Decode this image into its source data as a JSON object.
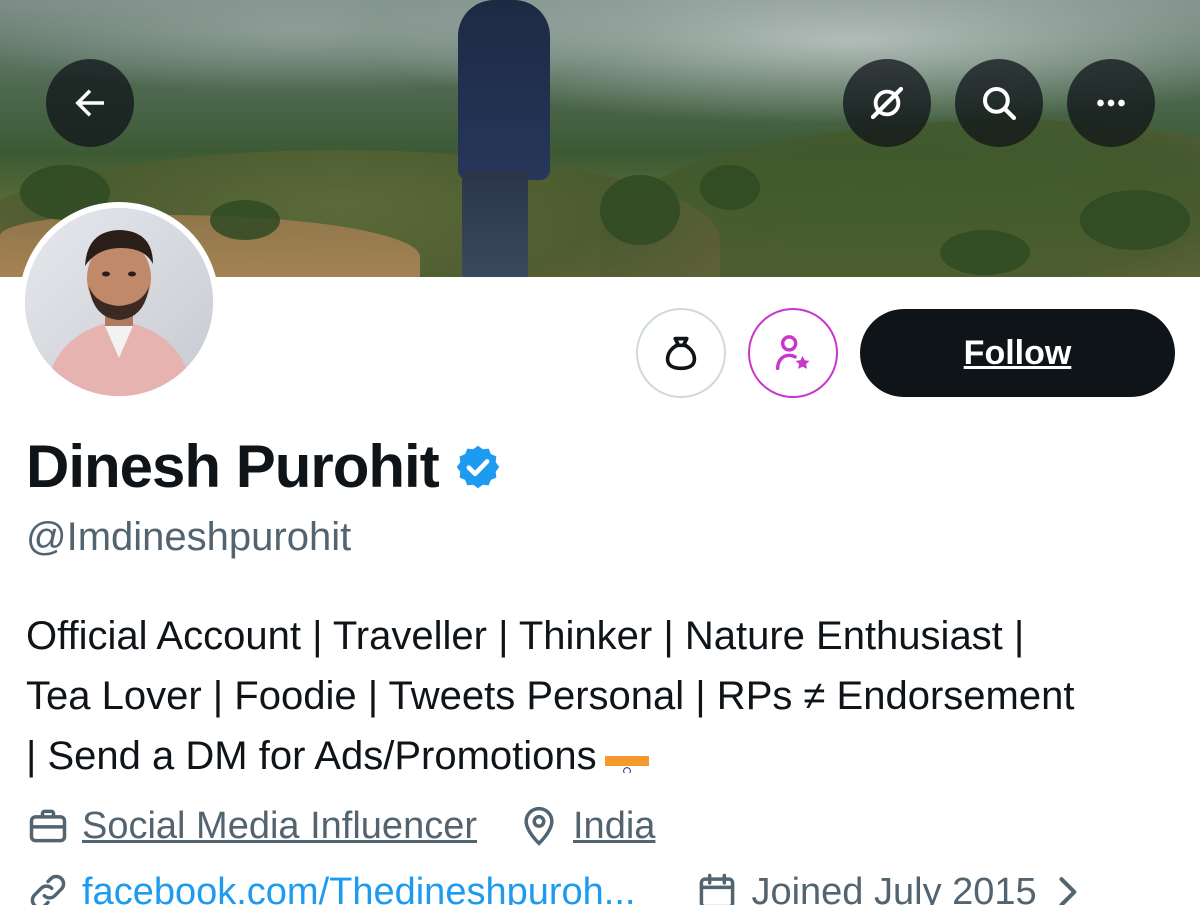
{
  "header": {
    "back_icon": "arrow-left-icon",
    "grok_icon": "grok-icon",
    "search_icon": "search-icon",
    "more_icon": "more-dots-icon"
  },
  "actions": {
    "tip_icon": "money-bag-icon",
    "subscribe_icon": "subscribe-person-star-icon",
    "follow_label": "Follow"
  },
  "profile": {
    "name": "Dinesh Purohit",
    "handle": "@Imdineshpurohit",
    "verified_color": "#1d9bf0",
    "bio_lines": [
      "Official Account | Traveller | Thinker | Nature Enthusiast |",
      "Tea Lover | Foodie | Tweets Personal | RPs ≠ Endorsement",
      "| Send a DM for Ads/Promotions"
    ],
    "profession": "Social Media Influencer",
    "location": "India",
    "website": "facebook.com/Thedineshpuroh...",
    "joined": "Joined July 2015"
  },
  "colors": {
    "text": "#0f1419",
    "secondary": "#536471",
    "link": "#1d9bf0",
    "subscribe_accent": "#c936cc"
  }
}
